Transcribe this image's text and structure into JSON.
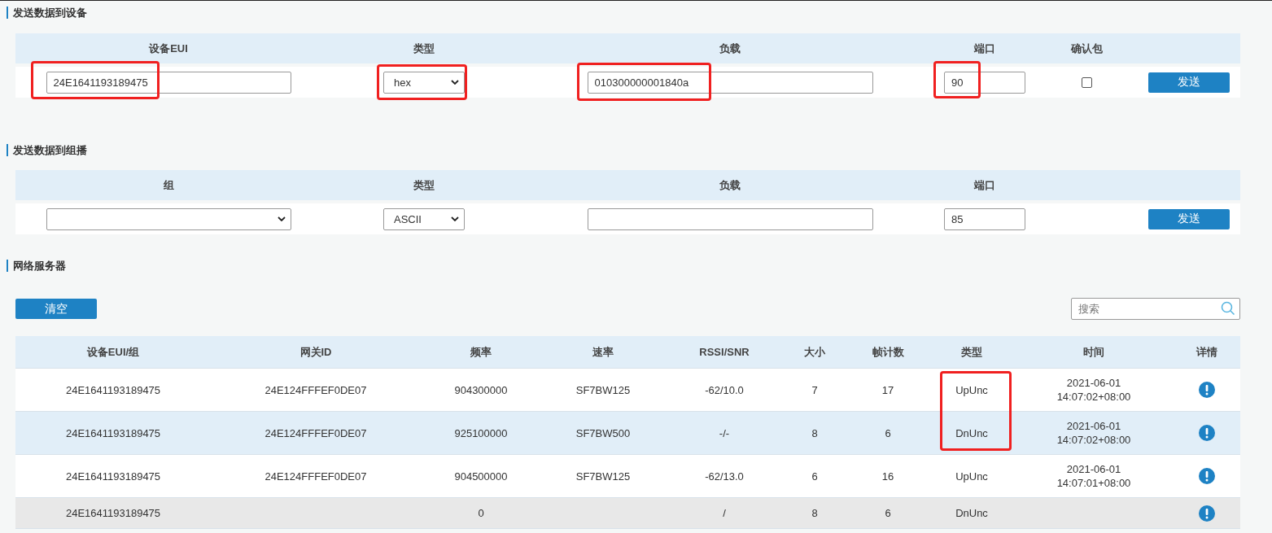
{
  "device_send": {
    "title": "发送数据到设备",
    "columns": [
      "设备EUI",
      "类型",
      "负载",
      "端口",
      "确认包"
    ],
    "eui": {
      "value": "24E1641193189475",
      "highlighted": true
    },
    "type": {
      "value": "hex",
      "highlighted": true
    },
    "payload": {
      "value": "010300000001840a",
      "highlighted": true
    },
    "port": {
      "value": "90",
      "highlighted": true
    },
    "confirmed": {
      "checked": false
    },
    "send_button": "发送"
  },
  "multicast_send": {
    "title": "发送数据到组播",
    "columns": [
      "组",
      "类型",
      "负载",
      "端口"
    ],
    "group": {
      "highlighted": false
    },
    "type": {
      "value": "ASCII",
      "highlighted": false
    },
    "payload": {
      "highlighted": false
    },
    "port": {
      "value": "85",
      "highlighted": false
    },
    "send_button": "发送"
  },
  "network_server": {
    "title": "网络服务器",
    "clear_button": "清空",
    "search": {
      "placeholder": "搜索"
    },
    "columns": [
      "设备EUI/组",
      "网关ID",
      "频率",
      "速率",
      "RSSI/SNR",
      "大小",
      "帧计数",
      "类型",
      "时间",
      "详情"
    ],
    "rows": [
      {
        "selected": false,
        "greyed": false,
        "type_highlighted": true,
        "cells": {
          "device": "24E1641193189475",
          "gateway": "24E124FFFEF0DE07",
          "frequency": "904300000",
          "rate": "SF7BW125",
          "rssi_snr": "-62/10.0",
          "size": "7",
          "frame_count": "17",
          "type": "UpUnc",
          "time": "2021-06-01\n14:07:02+08:00"
        }
      },
      {
        "selected": true,
        "greyed": false,
        "type_highlighted": true,
        "cells": {
          "device": "24E1641193189475",
          "gateway": "24E124FFFEF0DE07",
          "frequency": "925100000",
          "rate": "SF7BW500",
          "rssi_snr": "-/-",
          "size": "8",
          "frame_count": "6",
          "type": "DnUnc",
          "time": "2021-06-01\n14:07:02+08:00"
        }
      },
      {
        "selected": false,
        "greyed": false,
        "type_highlighted": false,
        "cells": {
          "device": "24E1641193189475",
          "gateway": "24E124FFFEF0DE07",
          "frequency": "904500000",
          "rate": "SF7BW125",
          "rssi_snr": "-62/13.0",
          "size": "6",
          "frame_count": "16",
          "type": "UpUnc",
          "time": "2021-06-01\n14:07:01+08:00"
        }
      },
      {
        "selected": false,
        "greyed": true,
        "type_highlighted": false,
        "cells": {
          "device": "24E1641193189475",
          "frequency": "0",
          "rssi_snr": "/",
          "size": "8",
          "frame_count": "6",
          "type": "DnUnc"
        }
      }
    ]
  }
}
